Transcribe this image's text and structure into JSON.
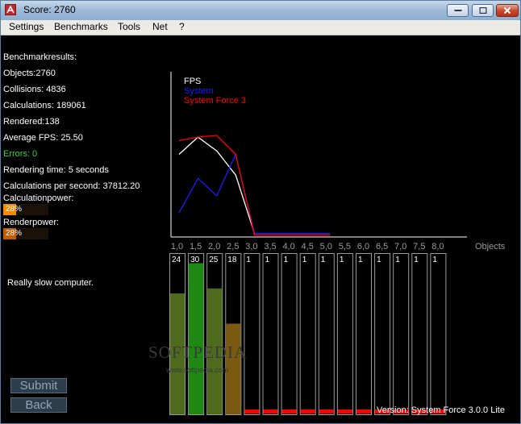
{
  "window": {
    "title": "Score: 2760",
    "buttons": [
      "minimize",
      "maximize",
      "close"
    ]
  },
  "menu": {
    "items": [
      {
        "label": "Settings"
      },
      {
        "label": "Benchmarks"
      },
      {
        "label": "Tools"
      },
      {
        "label": "Net"
      },
      {
        "label": "?"
      }
    ]
  },
  "stats": {
    "heading": "Benchmarkresults:",
    "objects": "Objects:2760",
    "collisions": "Collisions: 4836",
    "calculations": "Calculations: 189061",
    "rendered": "Rendered:138",
    "avg_fps": "Average FPS: 25.50",
    "errors": "Errors: 0",
    "render_time": "Rendering time: 5 seconds",
    "calc_per_sec": "Calculations per second: 37812.20",
    "calc_power_label": "Calculationpower:",
    "calc_power_value": "28%",
    "calc_power_fraction": 0.28,
    "render_power_label": "Renderpower:",
    "render_power_value": "28%",
    "render_power_fraction": 0.28
  },
  "status_text": "Really slow computer.",
  "buttons": {
    "submit": "Submit",
    "back": "Back"
  },
  "version": "Version: System Force 3.0.0 Lite",
  "watermark": {
    "brand": "SOFTPEDIA",
    "url": "www.softpedia.com"
  },
  "colors": {
    "fps": "#ffffff",
    "system": "#1a1aff",
    "system_force": "#ff0000",
    "bar_olive": "#4e6a1c",
    "bar_green": "#1e8a14",
    "bar_brown": "#7a5a10",
    "bar_red": "#ff0000"
  },
  "chart_data": [
    {
      "type": "line",
      "title": "",
      "xlabel": "Objects",
      "ylabel": "",
      "categories": [
        "1,0",
        "1,5",
        "2,0",
        "2,5",
        "3,0",
        "3,5",
        "4,0",
        "4,5",
        "5,0"
      ],
      "series": [
        {
          "name": "FPS",
          "values": [
            24,
            29,
            25,
            18,
            1,
            1,
            1,
            1,
            1
          ]
        },
        {
          "name": "System",
          "values": [
            7,
            17,
            12,
            24,
            1,
            1,
            1,
            1,
            1
          ]
        },
        {
          "name": "System Force 3",
          "values": [
            28,
            29,
            29.5,
            24,
            0.5,
            0.5,
            0.5,
            0.5,
            0.5
          ]
        }
      ],
      "ylim": [
        0,
        48
      ]
    },
    {
      "type": "bar",
      "title": "",
      "xlabel": "Objects",
      "ylabel": "",
      "categories": [
        "1,0",
        "1,5",
        "2,0",
        "2,5",
        "3,0",
        "3,5",
        "4,0",
        "4,5",
        "5,0",
        "5,5",
        "6,0",
        "6,5",
        "7,0",
        "7,5",
        "8,0"
      ],
      "values": [
        24,
        30,
        25,
        18,
        1,
        1,
        1,
        1,
        1,
        1,
        1,
        1,
        1,
        1,
        1
      ],
      "value_labels": [
        "24",
        "30",
        "25",
        "18",
        "1",
        "1",
        "1",
        "1",
        "1",
        "1",
        "1",
        "1",
        "1",
        "1",
        "1"
      ],
      "ylim": [
        0,
        32
      ]
    }
  ]
}
